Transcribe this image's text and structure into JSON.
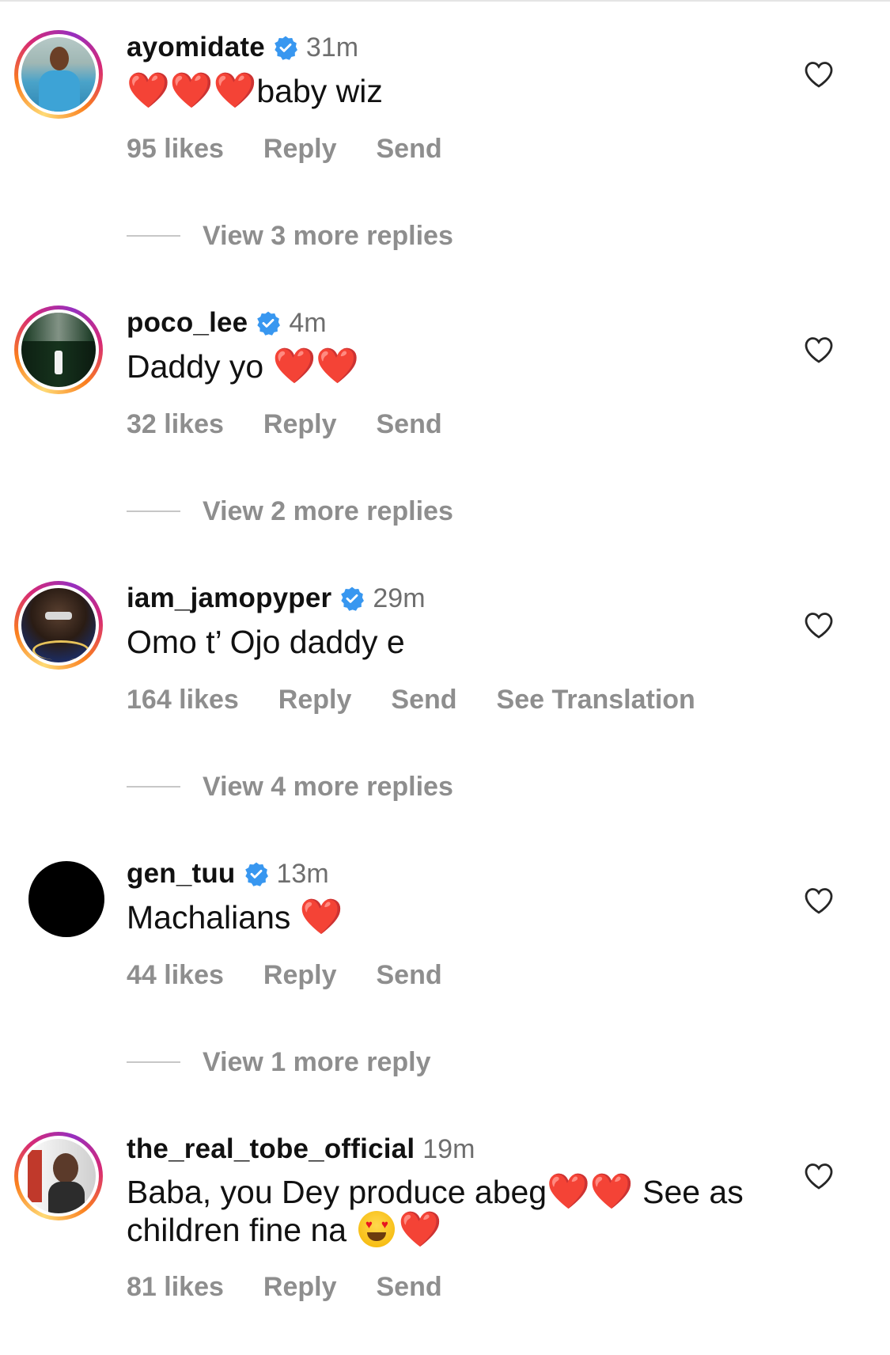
{
  "accent": {
    "like_grey": "#8e8e8e",
    "verified_blue": "#3897f0",
    "heart_red": "#e8141f"
  },
  "comments": [
    {
      "username": "ayomidate",
      "verified": true,
      "time": "31m",
      "text_after": "baby wiz",
      "likes": "95 likes",
      "reply": "Reply",
      "send": "Send",
      "view_replies": "View 3 more replies"
    },
    {
      "username": "poco_lee",
      "verified": true,
      "time": "4m",
      "text": "Daddy yo",
      "likes": "32 likes",
      "reply": "Reply",
      "send": "Send",
      "view_replies": "View 2 more replies"
    },
    {
      "username": "iam_jamopyper",
      "verified": true,
      "time": "29m",
      "text": "Omo t’ Ojo daddy e",
      "likes": "164 likes",
      "reply": "Reply",
      "send": "Send",
      "see_translation": "See Translation",
      "view_replies": "View 4 more replies"
    },
    {
      "username": "gen_tuu",
      "verified": true,
      "time": "13m",
      "text": "Machalians",
      "likes": "44 likes",
      "reply": "Reply",
      "send": "Send",
      "view_replies": "View 1 more reply"
    },
    {
      "username": "the_real_tobe_official",
      "verified": false,
      "time": "19m",
      "text_a": "Baba, you Dey produce abeg",
      "text_b": "See as children fine na",
      "likes": "81 likes",
      "reply": "Reply",
      "send": "Send"
    }
  ],
  "icons": {
    "like": "heart-outline-icon",
    "verified": "verified-badge-icon"
  }
}
